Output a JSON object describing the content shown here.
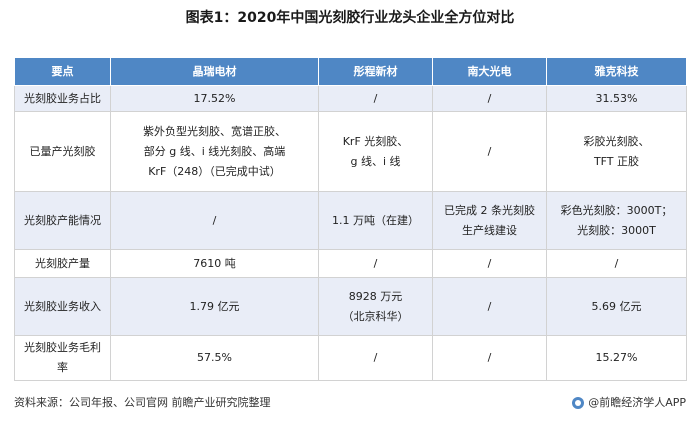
{
  "title": "图表1：2020年中国光刻胶行业龙头企业全方位对比",
  "table": {
    "headers": [
      "要点",
      "晶瑞电材",
      "彤程新材",
      "南大光电",
      "雅克科技"
    ],
    "rows": [
      {
        "label": "光刻胶业务占比",
        "cells": [
          [
            "17.52%"
          ],
          [
            "/"
          ],
          [
            "/"
          ],
          [
            "31.53%"
          ]
        ]
      },
      {
        "label": "已量产光刻胶",
        "cells": [
          [
            "紫外负型光刻胶、宽谱正胶、",
            "部分 g 线、i 线光刻胶、高端",
            "KrF（248）（已完成中试）"
          ],
          [
            "KrF 光刻胶、",
            "g 线、i 线"
          ],
          [
            "/"
          ],
          [
            "彩胶光刻胶、",
            "TFT 正胶"
          ]
        ]
      },
      {
        "label": "光刻胶产能情况",
        "cells": [
          [
            "/"
          ],
          [
            "1.1 万吨（在建）"
          ],
          [
            "已完成 2 条光刻胶",
            "生产线建设"
          ],
          [
            "彩色光刻胶：3000T；",
            "光刻胶：3000T"
          ]
        ]
      },
      {
        "label": "光刻胶产量",
        "cells": [
          [
            "7610 吨"
          ],
          [
            "/"
          ],
          [
            "/"
          ],
          [
            "/"
          ]
        ]
      },
      {
        "label": "光刻胶业务收入",
        "cells": [
          [
            "1.79 亿元"
          ],
          [
            "8928 万元",
            "（北京科华）"
          ],
          [
            "/"
          ],
          [
            "5.69 亿元"
          ]
        ]
      },
      {
        "label": "光刻胶业务毛利率",
        "cells": [
          [
            "57.5%"
          ],
          [
            "/"
          ],
          [
            "/"
          ],
          [
            "15.27%"
          ]
        ]
      }
    ]
  },
  "footer": {
    "source": "资料来源：公司年报、公司官网 前瞻产业研究院整理",
    "brand": "@前瞻经济学人APP"
  }
}
